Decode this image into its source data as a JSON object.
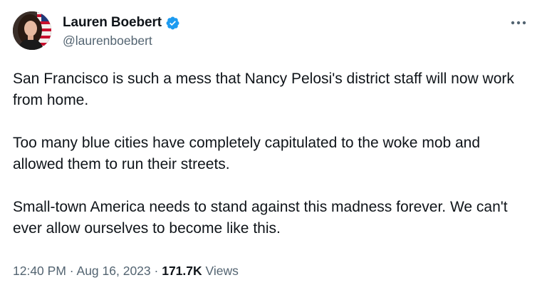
{
  "author": {
    "display_name": "Lauren Boebert",
    "handle": "@laurenboebert",
    "verified_icon": "verified-badge-icon"
  },
  "more_icon": "more-horizontal-icon",
  "tweet": {
    "paragraphs": [
      "San Francisco is such a mess that Nancy Pelosi's district staff will now work from home.",
      "Too many blue cities have completely capitulated to the woke mob and allowed them to run their streets.",
      "Small-town America needs to stand against this madness forever. We can't ever allow ourselves to become like this."
    ]
  },
  "meta": {
    "time": "12:40 PM",
    "separator": "·",
    "date": "Aug 16, 2023",
    "views_count": "171.7K",
    "views_label": "Views"
  },
  "colors": {
    "text_primary": "#0f1419",
    "text_secondary": "#536471",
    "verified_blue": "#1d9bf0"
  }
}
